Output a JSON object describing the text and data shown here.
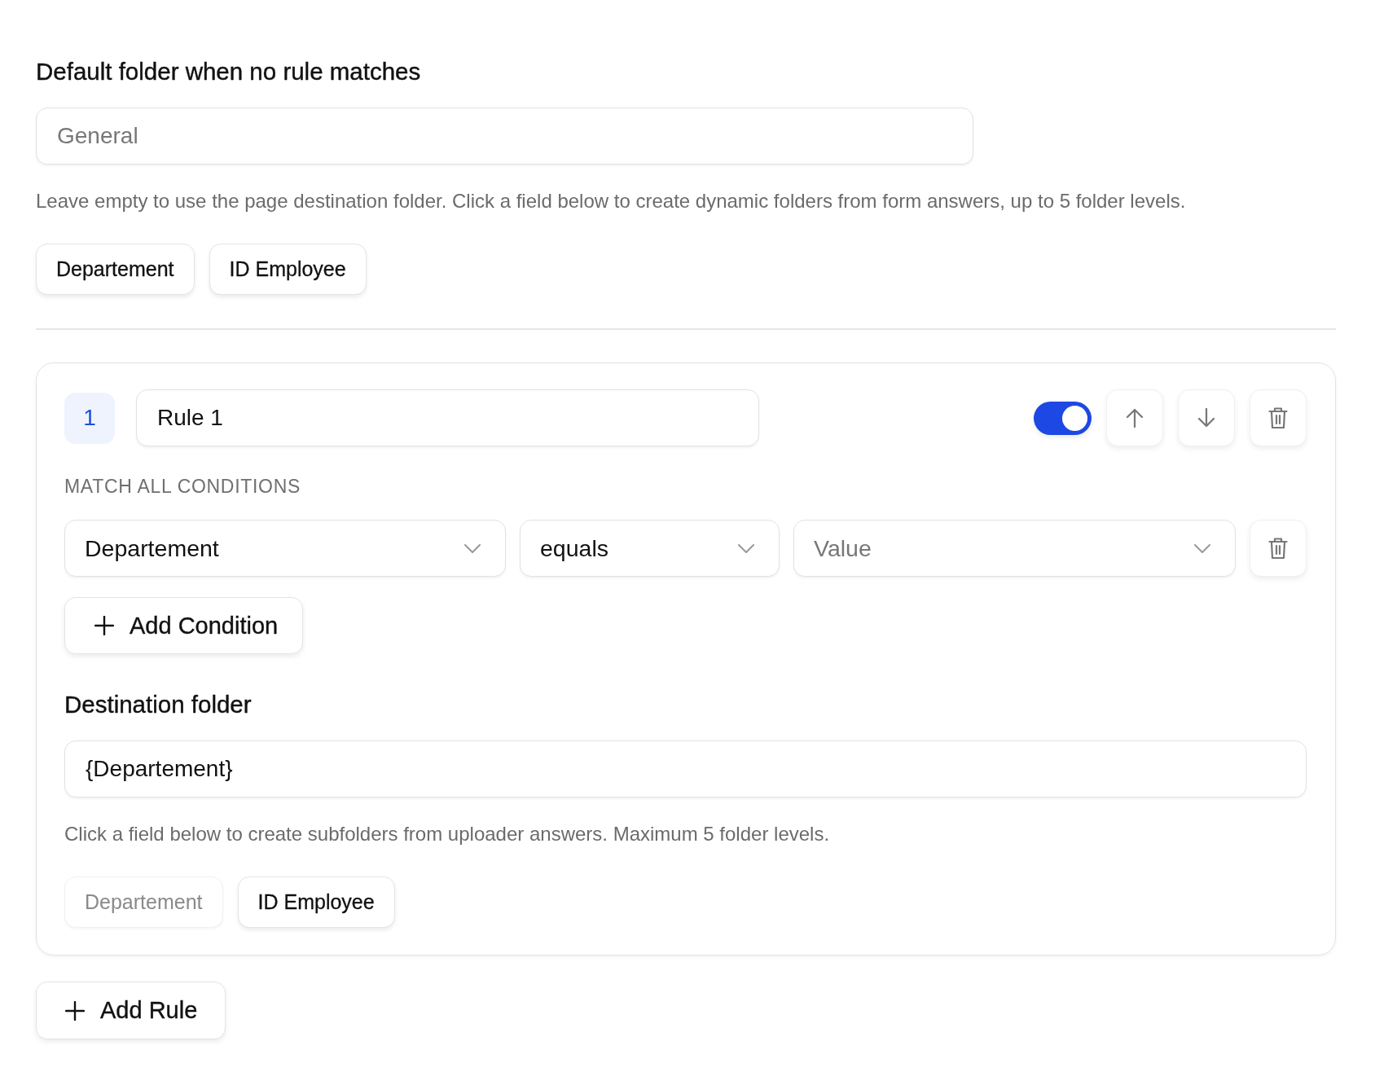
{
  "default_folder": {
    "label": "Default folder when no rule matches",
    "placeholder": "General",
    "help": "Leave empty to use the page destination folder. Click a field below to create dynamic folders from form answers, up to 5 folder levels.",
    "field_chips": [
      {
        "label": "Departement",
        "disabled": false
      },
      {
        "label": "ID Employee",
        "disabled": false
      }
    ]
  },
  "rules": [
    {
      "number": "1",
      "name": "Rule 1",
      "enabled": true,
      "conditions_label": "MATCH ALL CONDITIONS",
      "conditions": [
        {
          "field": "Departement",
          "operator": "equals",
          "value": {
            "placeholder": "Value"
          }
        }
      ],
      "add_condition": "Add Condition",
      "destination": {
        "label": "Destination folder",
        "value": "{Departement}",
        "help": "Click a field below to create subfolders from uploader answers. Maximum 5 folder levels.",
        "field_chips": [
          {
            "label": "Departement",
            "disabled": true
          },
          {
            "label": "ID Employee",
            "disabled": false
          }
        ]
      }
    }
  ],
  "add_rule": "Add Rule"
}
